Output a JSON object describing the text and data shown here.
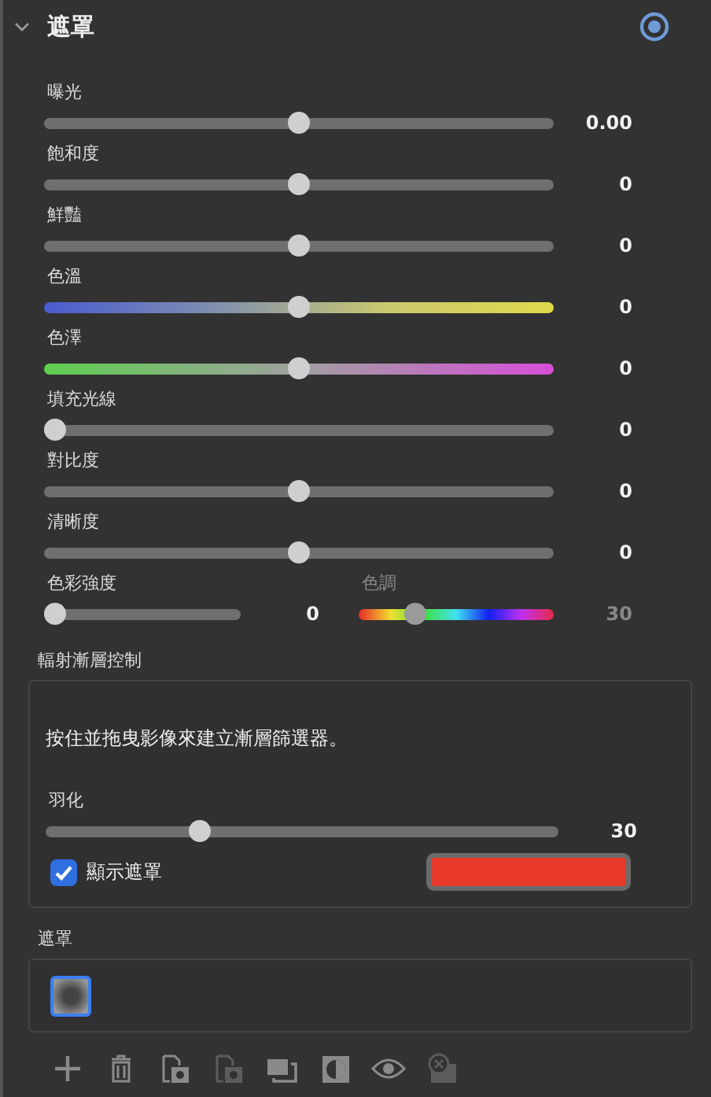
{
  "header": {
    "title": "遮罩",
    "expanded": true
  },
  "sliders": [
    {
      "label": "曝光",
      "kind": "plain",
      "level": 0.5,
      "value": "0.00"
    },
    {
      "label": "飽和度",
      "kind": "plain",
      "level": 0.5,
      "value": "0"
    },
    {
      "label": "鮮豔",
      "kind": "plain",
      "level": 0.5,
      "value": "0"
    },
    {
      "label": "色溫",
      "kind": "temperature",
      "level": 0.5,
      "value": "0"
    },
    {
      "label": "色澤",
      "kind": "tint",
      "level": 0.5,
      "value": "0"
    },
    {
      "label": "填充光線",
      "kind": "plain",
      "level": 0,
      "value": "0"
    },
    {
      "label": "對比度",
      "kind": "plain",
      "level": 0.5,
      "value": "0"
    },
    {
      "label": "清晰度",
      "kind": "plain",
      "level": 0.5,
      "value": "0"
    }
  ],
  "color_pair": [
    {
      "label": "色彩強度",
      "kind": "plain",
      "level": 0,
      "value": "0"
    },
    {
      "label": "色調",
      "kind": "hue",
      "level": 0.29,
      "value": "30",
      "disabled": true
    }
  ],
  "gradient": {
    "title": "輻射漸層控制",
    "hint": "按住並拖曳影像來建立漸層篩選器。",
    "feather": {
      "label": "羽化",
      "level": 0.3,
      "value": "30"
    },
    "show_mask": {
      "label": "顯示遮罩",
      "checked": true
    },
    "mask_swatch": {
      "color": "#e8392a"
    }
  },
  "masks": {
    "title": "遮罩",
    "items": [
      {
        "selected": true
      }
    ]
  },
  "toolbar": [
    {
      "kind": "add",
      "disabled": false
    },
    {
      "kind": "delete",
      "disabled": false
    },
    {
      "kind": "copy",
      "disabled": false
    },
    {
      "kind": "paste",
      "disabled": true
    },
    {
      "kind": "duplicate",
      "disabled": false
    },
    {
      "kind": "invert",
      "disabled": false
    },
    {
      "kind": "view",
      "disabled": false
    },
    {
      "kind": "clear",
      "disabled": true
    }
  ]
}
